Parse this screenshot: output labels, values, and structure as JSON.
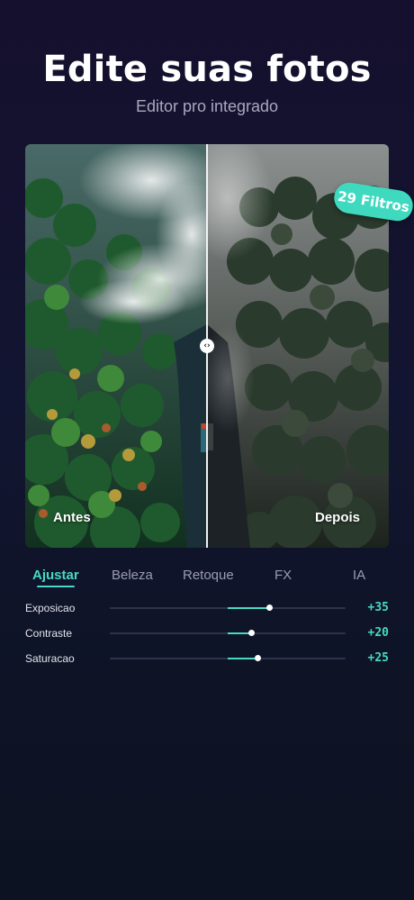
{
  "header": {
    "title": "Edite suas fotos",
    "subtitle": "Editor pro integrado"
  },
  "compare": {
    "before_label": "Antes",
    "after_label": "Depois",
    "handle_glyph": "‹›"
  },
  "badge": {
    "label": "29 Filtros"
  },
  "tabs": [
    {
      "label": "Ajustar",
      "active": true
    },
    {
      "label": "Beleza",
      "active": false
    },
    {
      "label": "Retoque",
      "active": false
    },
    {
      "label": "FX",
      "active": false
    },
    {
      "label": "IA",
      "active": false
    }
  ],
  "adjustments": [
    {
      "label": "Exposicao",
      "value_text": "+35",
      "value": 35
    },
    {
      "label": "Contraste",
      "value_text": "+20",
      "value": 20
    },
    {
      "label": "Saturacao",
      "value_text": "+25",
      "value": 25
    }
  ],
  "colors": {
    "accent": "#47d9c4",
    "badge": "#3fd9c0",
    "background_top": "#15102e",
    "background_bottom": "#0c1221"
  }
}
